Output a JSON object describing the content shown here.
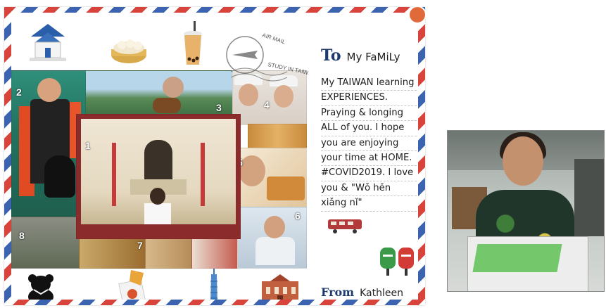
{
  "collage": {
    "photo_numbers": [
      "1",
      "2",
      "3",
      "4",
      "5",
      "6",
      "7",
      "8"
    ],
    "stamp_text": "AIR MAIL",
    "watermark_text": "STUDY IN TAIWAN"
  },
  "letter": {
    "to_label": "To",
    "to_name": "My FaMiLy",
    "message_lines": [
      "My TAIWAN learning",
      "EXPERIENCES.",
      "Praying & longing",
      "ALL of you. I hope",
      "you are enjoying",
      "your time at HOME.",
      "#COVID2019. I love",
      "you & \"Wǒ hěn",
      "xiǎng nǐ\""
    ],
    "from_label": "From",
    "from_name": "Kathleen"
  },
  "colors": {
    "airmail_red": "#d8433b",
    "airmail_blue": "#3c63b0",
    "ink_blue": "#1d3b6e"
  }
}
